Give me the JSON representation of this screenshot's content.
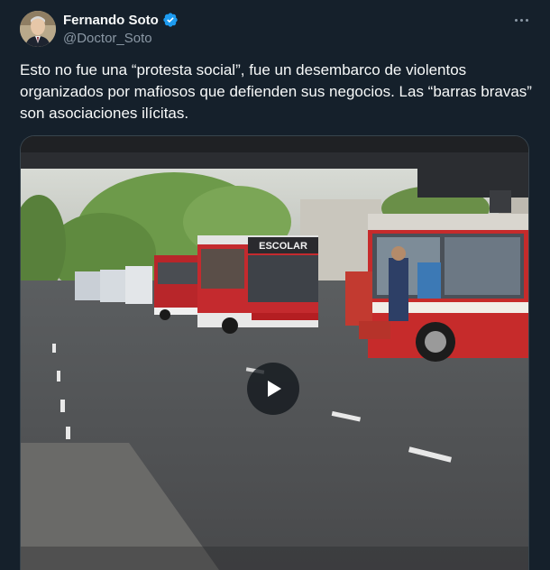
{
  "author": {
    "display_name": "Fernando Soto",
    "handle": "@Doctor_Soto",
    "verified": true
  },
  "tweet": {
    "text": "Esto no fue una “protesta social”, fue un desembarco de violentos organizados por mafiosos que defienden sus negocios. Las “barras bravas” son  asociaciones ilícitas."
  },
  "media": {
    "type": "video",
    "bus_sign": "ESCOLAR"
  },
  "icons": {
    "verified": "verified-badge-icon",
    "more": "more-options-icon",
    "play": "play-icon"
  },
  "colors": {
    "background": "#15202b",
    "text": "#f7f9f9",
    "secondary_text": "#8b98a5",
    "verified_blue": "#1d9bf0",
    "border": "#38444d"
  }
}
